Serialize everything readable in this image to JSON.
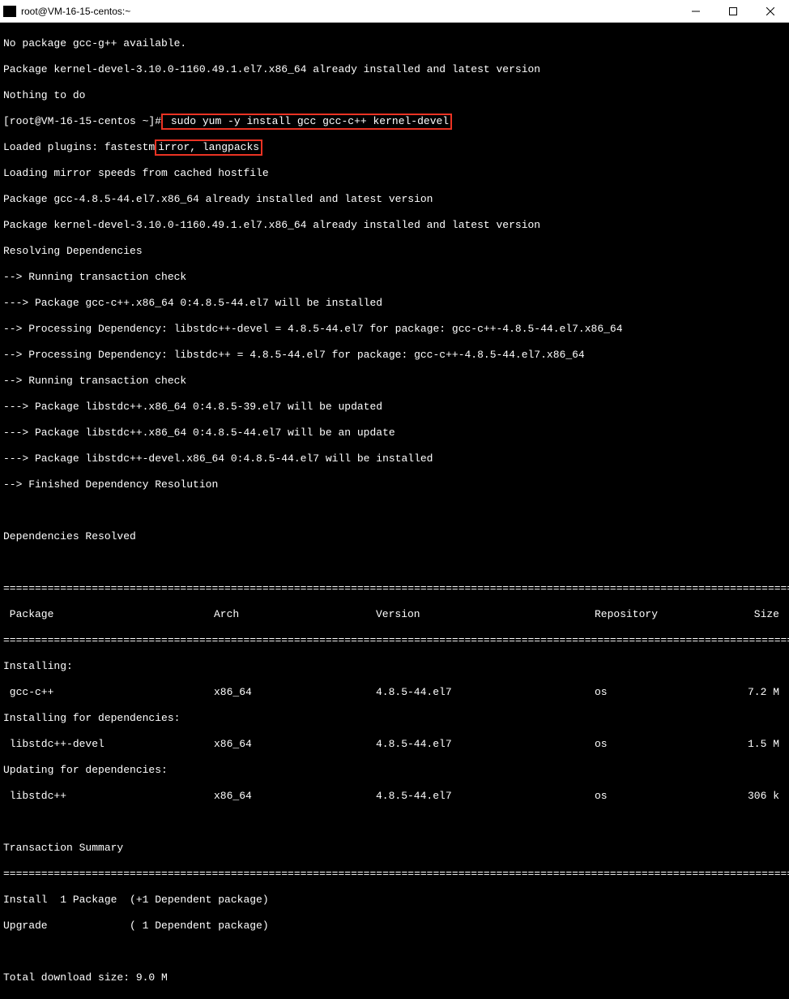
{
  "titlebar": {
    "title": "root@VM-16-15-centos:~"
  },
  "terminal": {
    "line1": "No package gcc-g++ available.",
    "line2": "Package kernel-devel-3.10.0-1160.49.1.el7.x86_64 already installed and latest version",
    "line3": "Nothing to do",
    "line4_prompt": "[root@VM-16-15-centos ~]#",
    "line4_cmd": " sudo yum -y install gcc gcc-c++ kernel-devel",
    "line5_a": "Loaded plugins: fastestm",
    "line5_b": "irror, langpacks",
    "line6": "Loading mirror speeds from cached hostfile",
    "line7": "Package gcc-4.8.5-44.el7.x86_64 already installed and latest version",
    "line8": "Package kernel-devel-3.10.0-1160.49.1.el7.x86_64 already installed and latest version",
    "line9": "Resolving Dependencies",
    "line10": "--> Running transaction check",
    "line11": "---> Package gcc-c++.x86_64 0:4.8.5-44.el7 will be installed",
    "line12": "--> Processing Dependency: libstdc++-devel = 4.8.5-44.el7 for package: gcc-c++-4.8.5-44.el7.x86_64",
    "line13": "--> Processing Dependency: libstdc++ = 4.8.5-44.el7 for package: gcc-c++-4.8.5-44.el7.x86_64",
    "line14": "--> Running transaction check",
    "line15": "---> Package libstdc++.x86_64 0:4.8.5-39.el7 will be updated",
    "line16": "---> Package libstdc++.x86_64 0:4.8.5-44.el7 will be an update",
    "line17": "---> Package libstdc++-devel.x86_64 0:4.8.5-44.el7 will be installed",
    "line18": "--> Finished Dependency Resolution",
    "line19": "",
    "line20": "Dependencies Resolved",
    "line21": "",
    "header": {
      "package": " Package",
      "arch": "Arch",
      "version": "Version",
      "repo": "Repository",
      "size": "Size"
    },
    "section_installing": "Installing:",
    "row1": {
      "package": " gcc-c++",
      "arch": "x86_64",
      "version": "4.8.5-44.el7",
      "repo": "os",
      "size": "7.2 M"
    },
    "section_installing_deps": "Installing for dependencies:",
    "row2": {
      "package": " libstdc++-devel",
      "arch": "x86_64",
      "version": "4.8.5-44.el7",
      "repo": "os",
      "size": "1.5 M"
    },
    "section_updating_deps": "Updating for dependencies:",
    "row3": {
      "package": " libstdc++",
      "arch": "x86_64",
      "version": "4.8.5-44.el7",
      "repo": "os",
      "size": "306 k"
    },
    "line_txsummary": "Transaction Summary",
    "line_install": "Install  1 Package  (+1 Dependent package)",
    "line_upgrade": "Upgrade             ( 1 Dependent package)",
    "line_total": "Total download size: 9.0 M"
  }
}
